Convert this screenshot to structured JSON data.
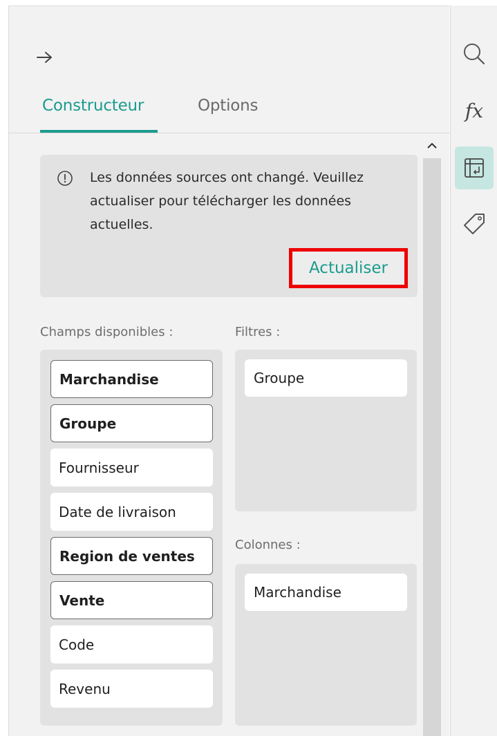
{
  "header": {
    "collapse_icon": "arrow-right-icon"
  },
  "tabs": [
    {
      "label": "Constructeur",
      "active": true
    },
    {
      "label": "Options",
      "active": false
    }
  ],
  "notice": {
    "icon": "info-circle-icon",
    "message": "Les données sources ont changé. Veuillez actualiser pour télécharger les données actuelles.",
    "refresh_label": "Actualiser"
  },
  "available_fields": {
    "label": "Champs disponibles :",
    "items": [
      {
        "label": "Marchandise",
        "used": true
      },
      {
        "label": "Groupe",
        "used": true
      },
      {
        "label": "Fournisseur",
        "used": false
      },
      {
        "label": "Date de livraison",
        "used": false
      },
      {
        "label": "Region de ventes",
        "used": true
      },
      {
        "label": "Vente",
        "used": true
      },
      {
        "label": "Code",
        "used": false
      },
      {
        "label": "Revenu",
        "used": false
      }
    ]
  },
  "filters": {
    "label": "Filtres :",
    "items": [
      "Groupe"
    ]
  },
  "columns": {
    "label": "Colonnes :",
    "items": [
      "Marchandise"
    ]
  },
  "right_rail": [
    {
      "icon": "search-icon",
      "active": false
    },
    {
      "icon": "function-fx-icon",
      "active": false
    },
    {
      "icon": "pivot-table-icon",
      "active": true
    },
    {
      "icon": "tag-icon",
      "active": false
    }
  ],
  "colors": {
    "accent": "#1a9c8e",
    "highlight_border": "#ee0000",
    "panel_bg": "#f2f2f2",
    "box_bg": "#e2e2e2",
    "active_rail_bg": "#c6e6e1"
  }
}
